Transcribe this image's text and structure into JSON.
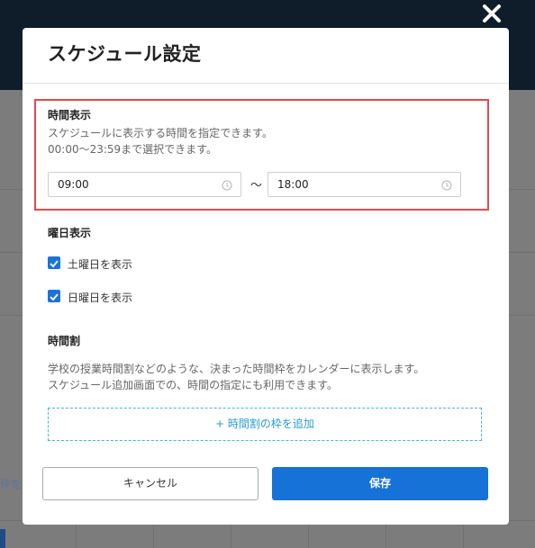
{
  "background": {
    "partial_link": "件を"
  },
  "dialog": {
    "title": "スケジュール設定",
    "close_icon": "close-icon",
    "time_display": {
      "title": "時間表示",
      "desc_line1": "スケジュールに表示する時間を指定できます。",
      "desc_line2": "00:00～23:59まで選択できます。",
      "start": "09:00",
      "end": "18:00",
      "separator": "～"
    },
    "weekday_display": {
      "title": "曜日表示",
      "saturday_label": "土曜日を表示",
      "saturday_checked": true,
      "sunday_label": "日曜日を表示",
      "sunday_checked": true
    },
    "timetable": {
      "title": "時間割",
      "desc_line1": "学校の授業時間割などのような、決まった時間枠をカレンダーに表示します。",
      "desc_line2": "スケジュール追加画面での、時間の指定にも利用できます。",
      "add_button": "+ 時間割の枠を追加"
    },
    "buttons": {
      "cancel": "キャンセル",
      "save": "保存"
    }
  },
  "colors": {
    "accent": "#1672d6",
    "highlight_border": "#e5484d",
    "dashed_border": "#4ab3d3"
  }
}
